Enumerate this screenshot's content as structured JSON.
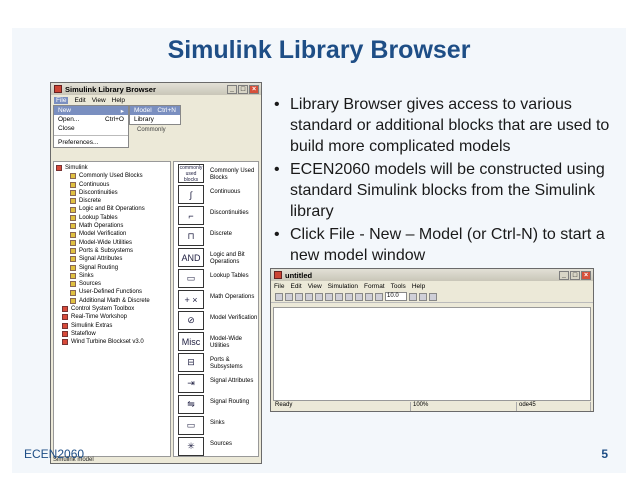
{
  "slide": {
    "title": "Simulink Library Browser",
    "bullets": [
      "Library Browser gives access to various standard or additional blocks that are used to build more complicated models",
      "ECEN2060 models will be constructed using standard Simulink blocks from the Simulink library",
      "Click File - New – Model (or Ctrl-N) to start a new model window"
    ],
    "footer_left": "ECEN2060",
    "page_number": "5"
  },
  "library_window": {
    "title": "Simulink Library Browser",
    "menu": [
      "File",
      "Edit",
      "View",
      "Help"
    ],
    "file_menu": [
      {
        "label": "New",
        "shortcut": "▸"
      },
      {
        "label": "Open...",
        "shortcut": "Ctrl+O"
      },
      {
        "label": "Close",
        "shortcut": ""
      },
      {
        "label": "Preferences...",
        "shortcut": ""
      }
    ],
    "new_submenu": [
      {
        "label": "Model",
        "shortcut": "Ctrl+N"
      },
      {
        "label": "Library",
        "shortcut": ""
      }
    ],
    "under_text": "Commonly",
    "tree_root": "Simulink",
    "tree_children": [
      "Commonly Used Blocks",
      "Continuous",
      "Discontinuities",
      "Discrete",
      "Logic and Bit Operations",
      "Lookup Tables",
      "Math Operations",
      "Model Verification",
      "Model-Wide Utilities",
      "Ports & Subsystems",
      "Signal Attributes",
      "Signal Routing",
      "Sinks",
      "Sources",
      "User-Defined Functions",
      "Additional Math & Discrete"
    ],
    "tree_top_level": [
      "Control System Toolbox",
      "Real-Time Workshop",
      "Simulink Extras",
      "Stateflow",
      "Wind Turbine Blockset v3.0"
    ],
    "blocks": [
      {
        "icon": "commonly used blocks",
        "label": "Commonly Used Blocks"
      },
      {
        "icon": "∫",
        "label": "Continuous"
      },
      {
        "icon": "⌐",
        "label": "Discontinuities"
      },
      {
        "icon": "⊓",
        "label": "Discrete"
      },
      {
        "icon": "AND",
        "label": "Logic and Bit Operations"
      },
      {
        "icon": "▭",
        "label": "Lookup Tables"
      },
      {
        "icon": "+ ×",
        "label": "Math Operations"
      },
      {
        "icon": "⊘",
        "label": "Model Verification"
      },
      {
        "icon": "Misc",
        "label": "Model-Wide Utilities"
      },
      {
        "icon": "⊟",
        "label": "Ports & Subsystems"
      },
      {
        "icon": "⇥",
        "label": "Signal Attributes"
      },
      {
        "icon": "⇋",
        "label": "Signal Routing"
      },
      {
        "icon": "▭",
        "label": "Sinks"
      },
      {
        "icon": "✳",
        "label": "Sources"
      }
    ],
    "status": "Simulink model"
  },
  "model_window": {
    "title": "untitled",
    "menu": [
      "File",
      "Edit",
      "View",
      "Simulation",
      "Format",
      "Tools",
      "Help"
    ],
    "zoom_value": "10.0",
    "status_ready": "Ready",
    "status_zoom": "100%",
    "status_solver": "ode45"
  }
}
